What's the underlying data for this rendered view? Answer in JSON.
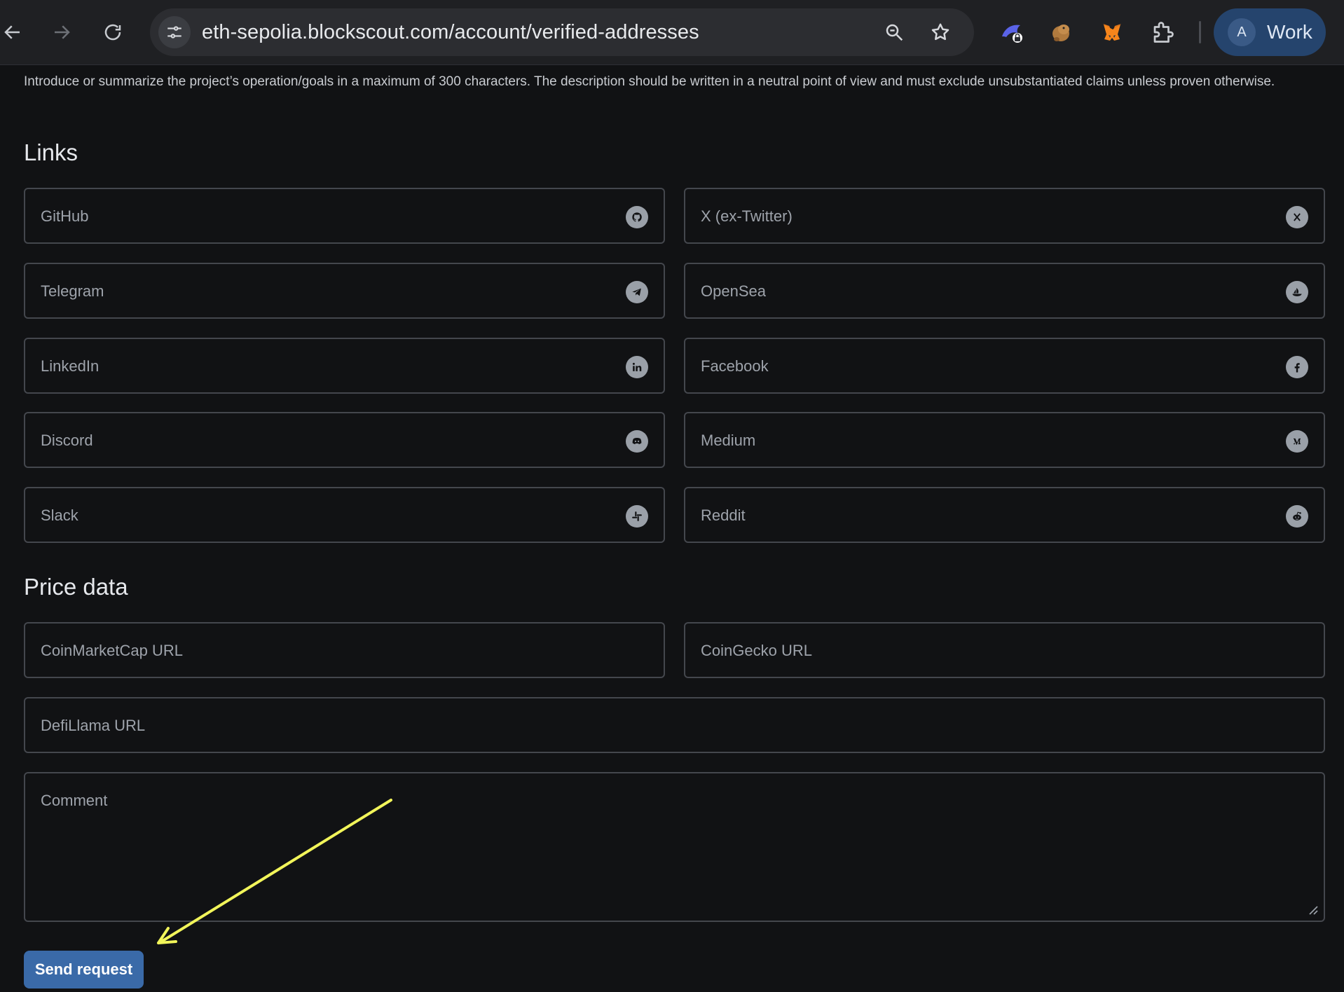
{
  "browser": {
    "url": "eth-sepolia.blockscout.com/account/verified-addresses",
    "profile_initial": "A",
    "profile_name": "Work"
  },
  "form": {
    "description_hint": "Introduce or summarize the project’s operation/goals in a maximum of 300 characters. The description should be written in a neutral point of view and must exclude unsubstantiated claims unless proven otherwise.",
    "links_title": "Links",
    "links": [
      {
        "label": "GitHub",
        "icon": "github-icon"
      },
      {
        "label": "X (ex-Twitter)",
        "icon": "x-twitter-icon"
      },
      {
        "label": "Telegram",
        "icon": "telegram-icon"
      },
      {
        "label": "OpenSea",
        "icon": "opensea-icon"
      },
      {
        "label": "LinkedIn",
        "icon": "linkedin-icon"
      },
      {
        "label": "Facebook",
        "icon": "facebook-icon"
      },
      {
        "label": "Discord",
        "icon": "discord-icon"
      },
      {
        "label": "Medium",
        "icon": "medium-icon"
      },
      {
        "label": "Slack",
        "icon": "slack-icon"
      },
      {
        "label": "Reddit",
        "icon": "reddit-icon"
      }
    ],
    "price_title": "Price data",
    "coinmarketcap_label": "CoinMarketCap URL",
    "coingecko_label": "CoinGecko URL",
    "defillama_label": "DefiLlama URL",
    "comment_label": "Comment",
    "send_label": "Send request"
  },
  "colors": {
    "accent_button": "#3a6aa8",
    "annotation_arrow": "#f2f55a"
  }
}
